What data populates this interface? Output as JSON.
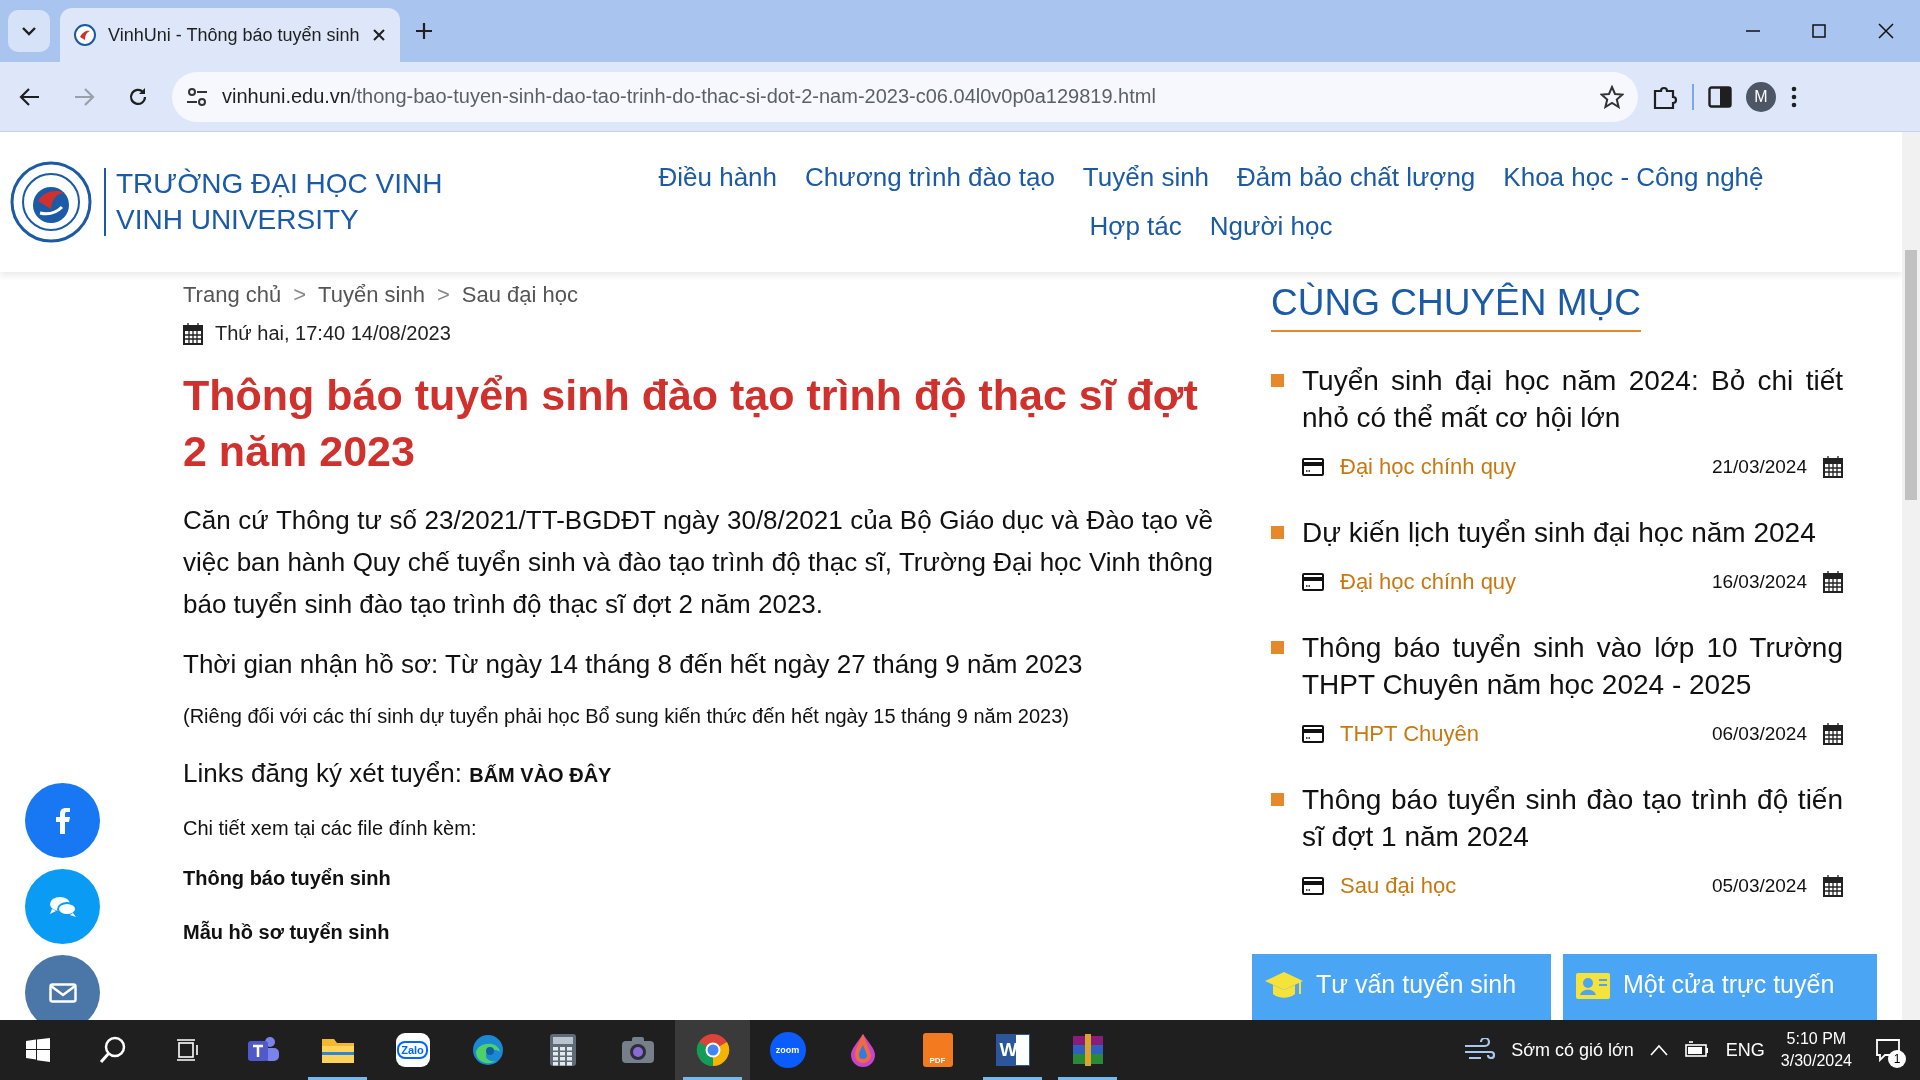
{
  "browser": {
    "tab_title": "VinhUni - Thông báo tuyển sinh",
    "nav_buttons": [
      {
        "kind": "back",
        "disabled": false
      },
      {
        "kind": "forward",
        "disabled": true
      },
      {
        "kind": "reload",
        "disabled": false
      }
    ],
    "url_domain": "vinhuni.edu.vn",
    "url_path": "/thong-bao-tuyen-sinh-dao-tao-trinh-do-thac-si-dot-2-nam-2023-c06.04l0v0p0a129819.html",
    "profile": "M"
  },
  "site": {
    "logo_lines": [
      "TRƯỜNG ĐẠI HỌC VINH",
      "VINH UNIVERSITY"
    ],
    "nav_rows": [
      {
        "items": [
          "Điều hành",
          "Chương trình đào tạo",
          "Tuyển sinh",
          "Đảm bảo chất lượng",
          "Khoa học - Công nghệ"
        ]
      },
      {
        "items": [
          "Hợp tác",
          "Người học"
        ]
      }
    ]
  },
  "breadcrumb": {
    "separator": ">",
    "items": [
      "Trang chủ",
      "Tuyển sinh",
      "Sau đại học"
    ]
  },
  "article": {
    "date": "Thứ hai, 17:40 14/08/2023",
    "title": "Thông báo tuyển sinh đào tạo trình độ thạc sĩ đợt 2 năm 2023",
    "blocks": [
      {
        "kind": "text",
        "text": "Căn cứ Thông tư số 23/2021/TT-BGDĐT ngày 30/8/2021 của Bộ Giáo dục và Đào tạo về việc ban hành Quy chế tuyển sinh và đào tạo trình độ thạc sĩ, Trường Đại học Vinh thông báo tuyển sinh đào tạo trình độ thạc sĩ đợt 2 năm 2023."
      },
      {
        "kind": "text",
        "text": "Thời gian nhận hồ sơ: Từ ngày 14 tháng 8 đến hết ngày 27 tháng 9 năm 2023"
      },
      {
        "kind": "small",
        "text": "(Riêng đối với các thí sinh dự tuyển phải học Bổ sung kiến thức đến hết ngày 15 tháng 9 năm 2023)"
      },
      {
        "kind": "link",
        "text": "Links đăng ký xét tuyển:",
        "link": "BẤM VÀO ĐÂY"
      },
      {
        "kind": "small",
        "text": "Chi tiết xem tại các file đính kèm:"
      },
      {
        "kind": "bold",
        "text": "Thông báo tuyển sinh"
      },
      {
        "kind": "bold",
        "text": "Mẫu hồ sơ tuyển sinh"
      }
    ]
  },
  "sidebar": {
    "heading": "CÙNG CHUYÊN MỤC",
    "items": [
      {
        "title": "Tuyển sinh đại học năm 2024: Bỏ chi tiết nhỏ có thể mất cơ hội lớn",
        "category": "Đại học chính quy",
        "date": "21/03/2024"
      },
      {
        "title": "Dự kiến lịch tuyển sinh đại học năm 2024",
        "category": "Đại học chính quy",
        "date": "16/03/2024"
      },
      {
        "title": "Thông báo tuyển sinh vào lớp 10 Trường THPT Chuyên năm học 2024 - 2025",
        "category": "THPT Chuyên",
        "date": "06/03/2024"
      },
      {
        "title": "Thông báo tuyển sinh đào tạo trình độ tiến sĩ đợt 1 năm 2024",
        "category": "Sau đại học",
        "date": "05/03/2024"
      }
    ]
  },
  "social_buttons": [
    {
      "kind": "facebook"
    },
    {
      "kind": "chat"
    },
    {
      "kind": "mail"
    }
  ],
  "quick_buttons": [
    {
      "kind": "advice",
      "label": "Tư vấn tuyển sinh"
    },
    {
      "kind": "online",
      "label": "Một cửa trực tuyến"
    }
  ],
  "taskbar": {
    "apps": [
      {
        "kind": "teams",
        "running": false,
        "selected": false
      },
      {
        "kind": "explorer",
        "running": true,
        "selected": false
      },
      {
        "kind": "zalo",
        "label": "Zalo",
        "running": false,
        "selected": false
      },
      {
        "kind": "edge",
        "running": false,
        "selected": false
      },
      {
        "kind": "calculator",
        "running": false,
        "selected": false
      },
      {
        "kind": "camera",
        "running": false,
        "selected": false
      },
      {
        "kind": "chrome",
        "running": true,
        "selected": true
      },
      {
        "kind": "zoom",
        "label": "zoom",
        "running": false,
        "selected": false
      },
      {
        "kind": "paint",
        "running": false,
        "selected": false
      },
      {
        "kind": "pdf",
        "label": "PDF",
        "running": false,
        "selected": false
      },
      {
        "kind": "word",
        "label": "W",
        "running": true,
        "selected": false
      },
      {
        "kind": "archive",
        "running": true,
        "selected": false
      }
    ],
    "weather": "Sớm có gió lớn",
    "language": "ENG",
    "time": "5:10 PM",
    "date": "3/30/2024",
    "notifications": "1"
  }
}
